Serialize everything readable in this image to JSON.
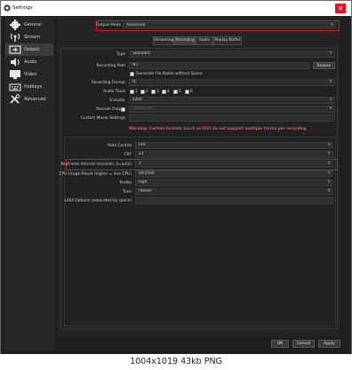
{
  "window": {
    "title": "Settings",
    "close_glyph": "✕"
  },
  "sidebar": {
    "items": [
      {
        "label": "General",
        "icon": "gear-icon"
      },
      {
        "label": "Stream",
        "icon": "broadcast-icon"
      },
      {
        "label": "Output",
        "icon": "output-icon",
        "active": true
      },
      {
        "label": "Audio",
        "icon": "speaker-icon"
      },
      {
        "label": "Video",
        "icon": "monitor-icon"
      },
      {
        "label": "Hotkeys",
        "icon": "keyboard-icon"
      },
      {
        "label": "Advanced",
        "icon": "wrench-icon"
      }
    ]
  },
  "output_mode": {
    "label": "Output Mode",
    "value": "Advanced"
  },
  "tabs": [
    "Streaming",
    "Recording",
    "Audio",
    "Replay Buffer"
  ],
  "active_tab": "Recording",
  "recording": {
    "type_label": "Type",
    "type_value": "Standard",
    "path_label": "Recording Path",
    "path_value": "N:/",
    "browse_label": "Browse",
    "nospace_label": "Generate File Name without Space",
    "format_label": "Recording Format",
    "format_value": "ts",
    "tracks_label": "Audio Track",
    "tracks": [
      "1",
      "2",
      "3",
      "4",
      "5",
      "6"
    ],
    "encoder_label": "Encoder",
    "encoder_value": "x264",
    "rescale_label": "Rescale Output",
    "rescale_value": "1280x720",
    "muxer_label": "Custom Muxer Settings",
    "warning": "Warning: Certain formats (such as FLV) do not support multiple tracks per recording"
  },
  "encoder_settings": {
    "rate_control_label": "Rate Control",
    "rate_control_value": "CRF",
    "crf_label": "CRF",
    "crf_value": "21",
    "keyframe_label": "Keyframe Interval (seconds, 0=auto)",
    "keyframe_value": "2",
    "preset_label": "CPU Usage Preset (higher = less CPU)",
    "preset_value": "veryfast",
    "profile_label": "Profile",
    "profile_value": "high",
    "tune_label": "Tune",
    "tune_value": "(None)",
    "x264opts_label": "x264 Options (separated by space)"
  },
  "footer": {
    "ok": "OK",
    "cancel": "Cancel",
    "apply": "Apply"
  },
  "caption": "1004x1019 43kb PNG",
  "colors": {
    "highlight": "#d11c1c",
    "warning": "#d65f5f",
    "background": "#1f1f1f"
  }
}
